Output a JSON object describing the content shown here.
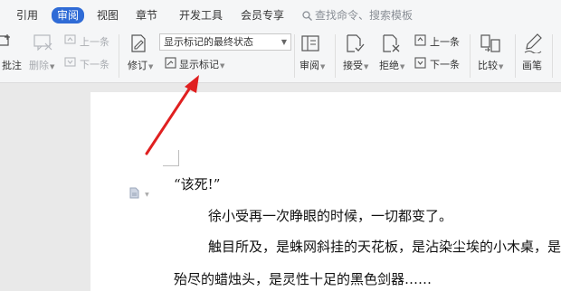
{
  "menubar": {
    "tabs": [
      "引用",
      "审阅",
      "视图",
      "章节",
      "开发工具",
      "会员专享"
    ],
    "active_tab": "审阅",
    "search_placeholder": "查找命令、搜索模板"
  },
  "ribbon": {
    "comment_label": "批注",
    "delete_label": "删除",
    "prev_comment_label": "上一条",
    "next_comment_label": "下一条",
    "track_label": "修订",
    "markup_state_value": "显示标记的最终状态",
    "show_markup_label": "显示标记",
    "review_pane_label": "审阅",
    "accept_label": "接受",
    "reject_label": "拒绝",
    "prev_change_label": "上一条",
    "next_change_label": "下一条",
    "compare_label": "比较",
    "pen_label": "画笔"
  },
  "document": {
    "line1": "“该死!”",
    "line2": "徐小受再一次睁眼的时候，一切都变了。",
    "line3": "触目所及，是蛛网斜挂的天花板，是沾染尘埃的小木桌，是",
    "line4": "殆尽的蜡烛头，是灵性十足的黑色剑器……"
  },
  "colors": {
    "accent": "#2f6bd6",
    "annotation_arrow": "#e02020"
  }
}
